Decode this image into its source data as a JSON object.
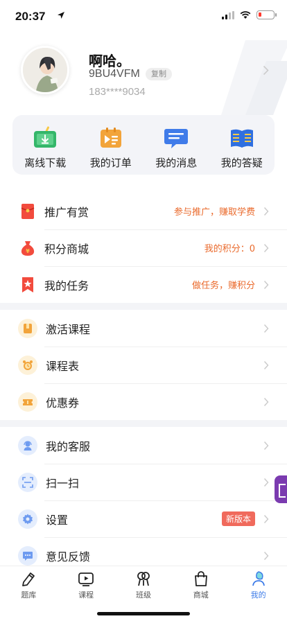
{
  "status_bar": {
    "time": "20:37",
    "battery_level": 0.2,
    "battery_color": "#ff3b30"
  },
  "profile": {
    "name": "啊哈。",
    "user_id": "9BU4VFM",
    "copy_label": "复制",
    "phone": "183****9034"
  },
  "quick_actions": [
    {
      "label": "离线下载",
      "icon": "download-tv-icon",
      "color": "#34b66a"
    },
    {
      "label": "我的订单",
      "icon": "order-ticket-icon",
      "color": "#f2a43b"
    },
    {
      "label": "我的消息",
      "icon": "message-bubble-icon",
      "color": "#3f7be9"
    },
    {
      "label": "我的答疑",
      "icon": "open-book-icon",
      "color": "#2f6fe0"
    }
  ],
  "section1": [
    {
      "label": "推广有赏",
      "extra": "参与推广，赚取学费",
      "icon": "red-envelope-icon"
    },
    {
      "label": "积分商城",
      "extra": "我的积分：0",
      "icon": "money-bag-icon"
    },
    {
      "label": "我的任务",
      "extra": "做任务，赚积分",
      "icon": "star-bookmark-icon"
    }
  ],
  "section2": [
    {
      "label": "激活课程",
      "icon": "activate-course-icon"
    },
    {
      "label": "课程表",
      "icon": "alarm-clock-icon"
    },
    {
      "label": "优惠券",
      "icon": "coupon-icon"
    }
  ],
  "section3": [
    {
      "label": "我的客服",
      "icon": "customer-service-icon"
    },
    {
      "label": "扫一扫",
      "icon": "scan-icon"
    },
    {
      "label": "设置",
      "icon": "gear-icon",
      "badge": "新版本"
    },
    {
      "label": "意见反馈",
      "icon": "feedback-icon"
    }
  ],
  "tab_bar": [
    {
      "label": "题库",
      "icon": "pencil-icon"
    },
    {
      "label": "课程",
      "icon": "video-play-icon"
    },
    {
      "label": "班级",
      "icon": "class-group-icon"
    },
    {
      "label": "商城",
      "icon": "shopping-bag-icon"
    },
    {
      "label": "我的",
      "icon": "profile-leaf-icon",
      "active": true
    }
  ],
  "colors": {
    "accent": "#3c7be8",
    "orange_text": "#ea6a2c",
    "badge_red": "#f06a5c"
  }
}
